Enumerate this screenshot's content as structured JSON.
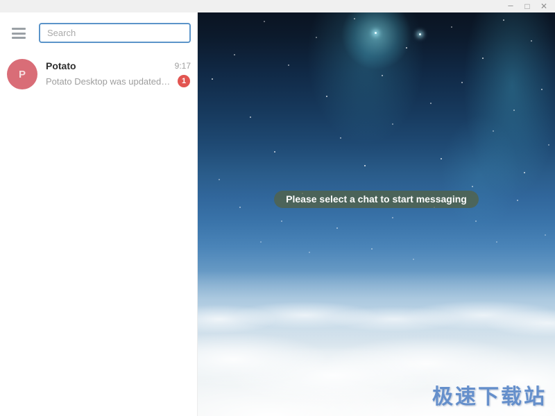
{
  "window": {
    "title": "",
    "controls": {
      "minimize_glyph": "–",
      "maximize_glyph": "□",
      "close_glyph": "✕"
    }
  },
  "sidebar": {
    "menu_icon": "hamburger-menu",
    "search": {
      "placeholder": "Search",
      "value": ""
    },
    "chats": [
      {
        "avatar_letter": "P",
        "name": "Potato",
        "time": "9:17",
        "preview": "Potato Desktop was updated…",
        "unread_count": "1"
      }
    ]
  },
  "main": {
    "empty_state_message": "Please select a chat to start messaging",
    "watermark_text": "极速下载站"
  },
  "colors": {
    "titlebar_bg": "#f0f0f0",
    "search_border": "#5b94c9",
    "avatar_bg": "#d96d77",
    "badge_bg": "#e25551",
    "pill_bg": "rgba(83,99,73,0.8)",
    "watermark": "#4d7fc4",
    "sky_top": "#0a1422",
    "sky_mid": "#31679c",
    "clouds": "#f2f4f5"
  }
}
